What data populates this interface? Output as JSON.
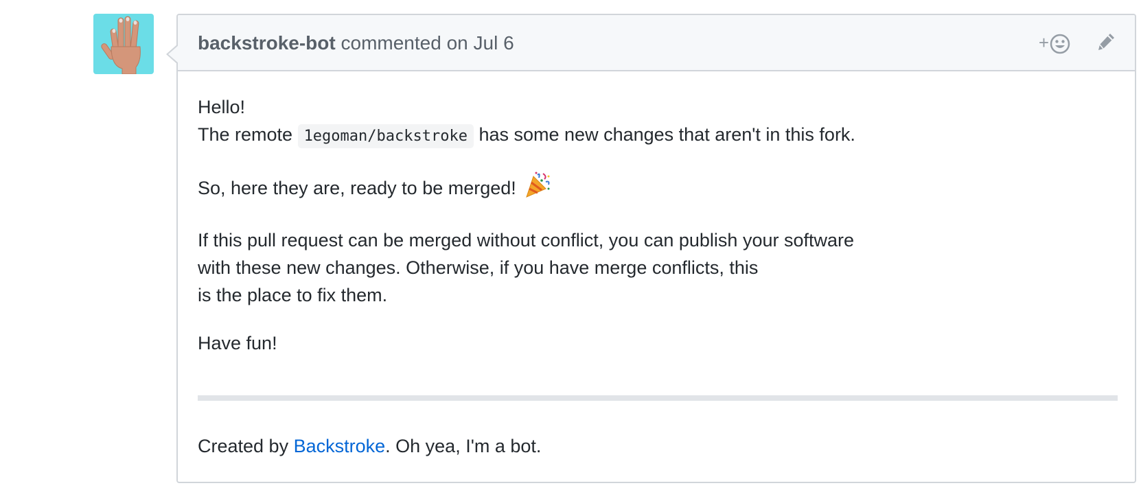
{
  "avatar": {
    "icon": "raised-hand-icon",
    "bg_color": "#6bdde7"
  },
  "header": {
    "author": "backstroke-bot",
    "action": " commented on Jul 6",
    "reaction_plus": "+",
    "reaction_icon": "smiley-icon",
    "edit_icon": "pencil-icon"
  },
  "body": {
    "greeting": "Hello!",
    "remote_prefix": "The remote ",
    "remote_code": "1egoman/backstroke",
    "remote_suffix": " has some new changes that aren't in this fork.",
    "merged_line": "So, here they are, ready to be merged! ",
    "merged_emoji": "party-popper-icon",
    "para_line1": "If this pull request can be merged without conflict, you can publish your software",
    "para_line2": "with these new changes. Otherwise, if you have merge conflicts, this",
    "para_line3": "is the place to fix them.",
    "have_fun": "Have fun!"
  },
  "footer": {
    "prefix": "Created by ",
    "link_text": "Backstroke",
    "suffix": ". Oh yea, I'm a bot."
  },
  "colors": {
    "link": "#0366d6",
    "header_bg": "#f6f8fa",
    "border": "#d1d5da"
  }
}
